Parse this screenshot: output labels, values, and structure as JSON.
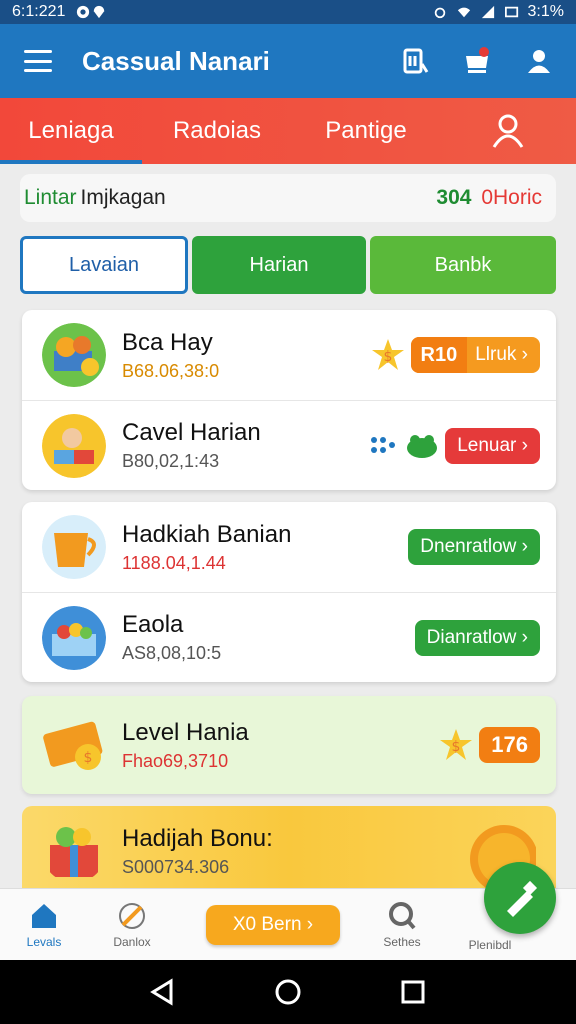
{
  "status": {
    "time": "6:1:221",
    "battery": "3:1%"
  },
  "appbar": {
    "title": "Cassual Nanari"
  },
  "tabs": [
    {
      "label": "Leniaga"
    },
    {
      "label": "Radoias"
    },
    {
      "label": "Pantige"
    }
  ],
  "info": {
    "left_green": "Lintar",
    "left_dark": "Imjkagan",
    "right_num": "304",
    "right_red": "0Horic"
  },
  "filters": [
    {
      "label": "Lavaian"
    },
    {
      "label": "Harian"
    },
    {
      "label": "Banbk"
    }
  ],
  "card1": [
    {
      "title": "Bca Hay",
      "sub": "B68.06,38:0",
      "amount": "R10",
      "action": "Llruk ›"
    },
    {
      "title": "Cavel Harian",
      "sub": "B80,02,1:43",
      "action": "Lenuar ›"
    }
  ],
  "card2": [
    {
      "title": "Hadkiah Banian",
      "sub": "1188.04,1.44",
      "action": "Dnenratlow ›"
    },
    {
      "title": "Eaola",
      "sub": "AS8,08,10:5",
      "action": "Dianratlow ›"
    }
  ],
  "level": {
    "title": "Level Hania",
    "sub": "Fhao69,3710",
    "amount": "176"
  },
  "bonus": {
    "title": "Hadijah Bonu:",
    "sub": "S000734.306"
  },
  "nav": [
    {
      "label": "Levals"
    },
    {
      "label": "Danlox"
    },
    {
      "label": "Sethes"
    },
    {
      "label": "Plenibdl"
    }
  ],
  "earn_label": "X0 Bern ›",
  "colors": {
    "appbar": "#1f77c0",
    "tabs": "#f2483a",
    "green": "#2ea23c",
    "orange": "#f59a1f",
    "red": "#e53a3a"
  }
}
